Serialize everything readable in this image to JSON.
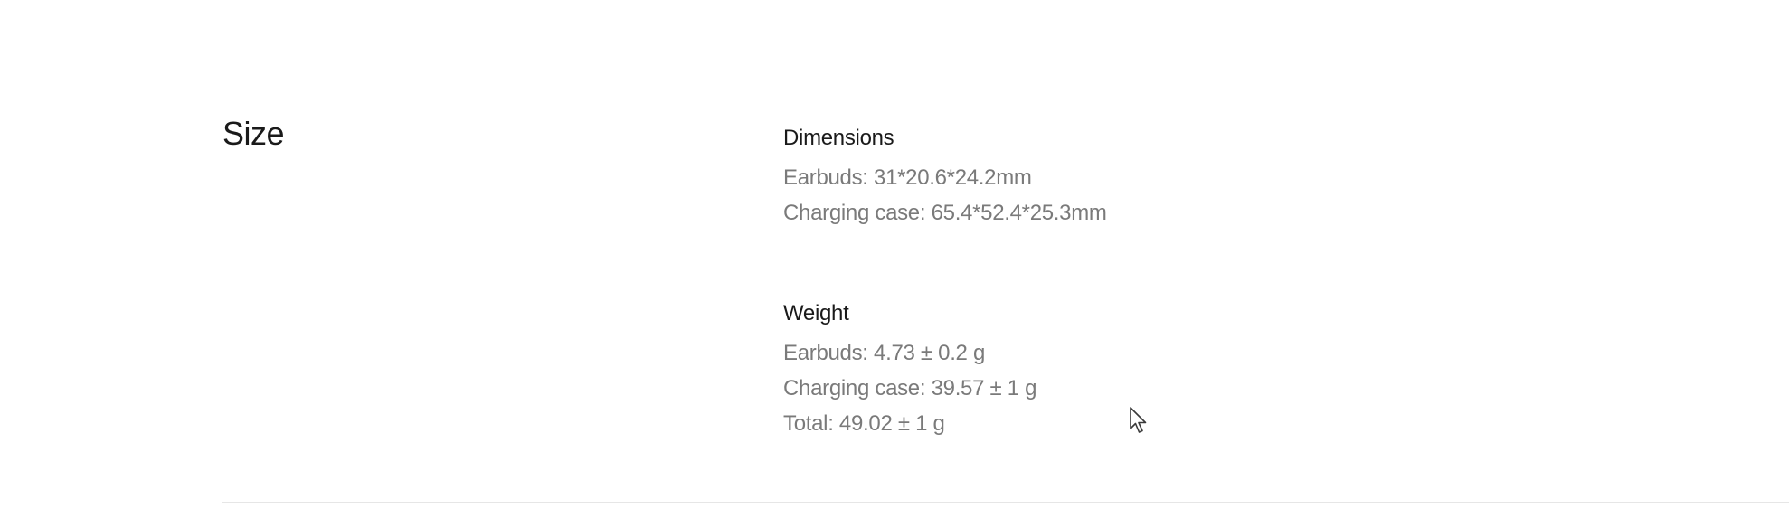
{
  "section": {
    "title": "Size"
  },
  "dimensions": {
    "heading": "Dimensions",
    "lines": [
      "Earbuds: 31*20.6*24.2mm",
      "Charging case: 65.4*52.4*25.3mm"
    ]
  },
  "weight": {
    "heading": "Weight",
    "lines": [
      "Earbuds: 4.73 ± 0.2 g",
      "Charging case: 39.57 ± 1 g",
      "Total: 49.02 ± 1 g"
    ]
  },
  "icons": {
    "cursor": "mouse-pointer-icon"
  }
}
